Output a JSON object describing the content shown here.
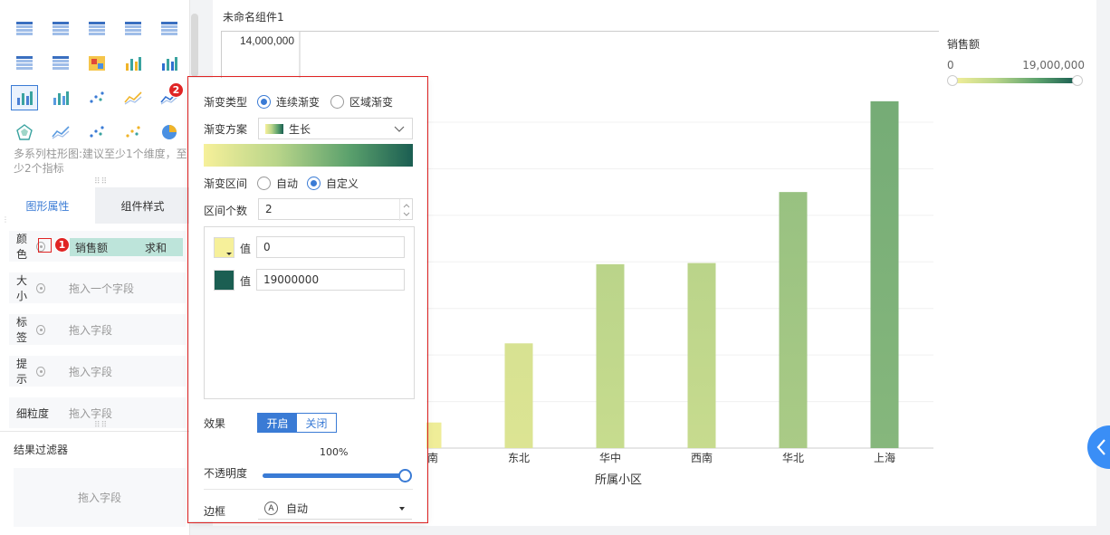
{
  "left_panel": {
    "icons": [
      "table-icon",
      "crosstab-icon",
      "detail-table-icon",
      "kpi-grid-icon",
      "number-icon",
      "heat-table-icon",
      "dot-table-icon",
      "heatmap-icon",
      "stacked-column-icon",
      "column-icon",
      "multi-column-icon",
      "bar-icon",
      "scatter-column-icon",
      "line-icon",
      "trend-line-icon",
      "radar-icon",
      "area-icon",
      "scatter-icon",
      "bubble-icon",
      "pie-icon"
    ],
    "hint": "多系列柱形图:建议至少1个维度，至少2个指标",
    "tabs": {
      "shape": "图形属性",
      "style": "组件样式"
    },
    "props": {
      "color": "颜色",
      "color_field": "销售额",
      "color_agg": "求和",
      "size": "大小",
      "size_placeholder": "拖入一个字段",
      "label": "标签",
      "tip": "提示",
      "granularity": "细粒度",
      "drop": "拖入字段"
    },
    "filter_title": "结果过滤器",
    "filter_drop": "拖入字段"
  },
  "badges": {
    "one": "1",
    "two": "2"
  },
  "main": {
    "widget_title": "未命名组件1",
    "legend": {
      "title": "销售额",
      "min": "0",
      "max": "19,000,000"
    }
  },
  "popup": {
    "gradient_type_label": "渐变类型",
    "gradient_continuous": "连续渐变",
    "gradient_region": "区域渐变",
    "scheme_label": "渐变方案",
    "scheme_value": "生长",
    "range_label": "渐变区间",
    "range_auto": "自动",
    "range_custom": "自定义",
    "count_label": "区间个数",
    "count_value": "2",
    "value_label": "值",
    "stop1_value": "0",
    "stop2_value": "19000000",
    "effect_label": "效果",
    "effect_on": "开启",
    "effect_off": "关闭",
    "opacity_label": "不透明度",
    "opacity_value": "100%",
    "opacity_fraction": 1.0,
    "border_label": "边框",
    "border_value": "自动",
    "colors": {
      "start": "#f6f09a",
      "end": "#1b5e52",
      "accent": "#3a7bd5"
    }
  },
  "chart_data": {
    "type": "bar",
    "xlabel": "所属小区",
    "ylabel": "",
    "y_top_tick": "14,000,000",
    "categories": [
      "中南",
      "东北",
      "华中",
      "西南",
      "华北",
      "上海"
    ],
    "values": [
      1100000,
      4500000,
      7900000,
      7950000,
      11000000,
      14900000
    ],
    "ylim": [
      0,
      17500000
    ],
    "color_range": [
      0,
      19000000
    ],
    "grid": true
  }
}
